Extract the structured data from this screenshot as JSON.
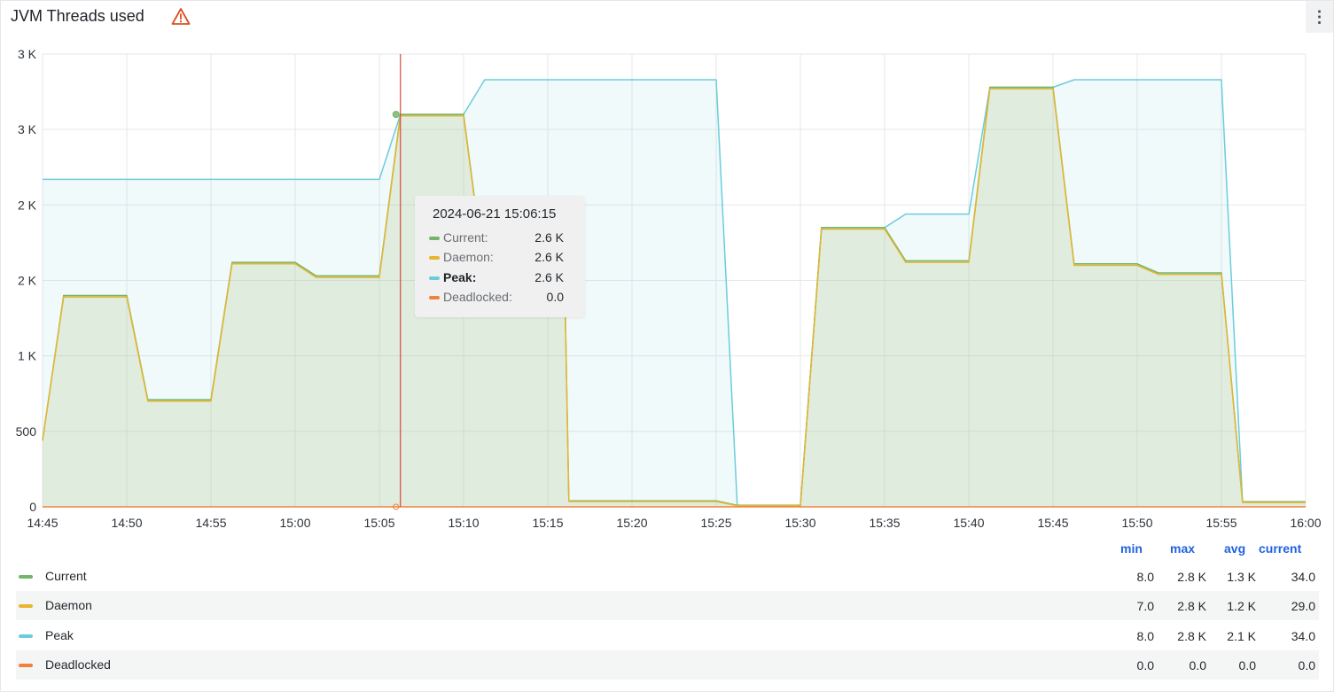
{
  "panel": {
    "title": "JVM Threads used",
    "warning_icon": "warning-triangle-icon",
    "menu_icon": "vertical-dots-icon",
    "warning_color": "#e35a1a"
  },
  "colors": {
    "current": "#73b56a",
    "daemon": "#e8b530",
    "peak": "#6cccdb",
    "deadlocked": "#f0803c",
    "cursor": "#d44a3a"
  },
  "chart_data": {
    "type": "area",
    "title": "JVM Threads used",
    "y_ticks": [
      "0",
      "500",
      "1 K",
      "2 K",
      "2 K",
      "3 K",
      "3 K"
    ],
    "y_tick_values": [
      0,
      500,
      1000,
      1500,
      2000,
      2500,
      3000
    ],
    "ylim": [
      0,
      3000
    ],
    "x_ticks": [
      "14:45",
      "14:50",
      "14:55",
      "15:00",
      "15:05",
      "15:10",
      "15:15",
      "15:20",
      "15:25",
      "15:30",
      "15:35",
      "15:40",
      "15:45",
      "15:50",
      "15:55",
      "16:00"
    ],
    "x_range_minutes": [
      0,
      75
    ],
    "grid": true,
    "series": [
      {
        "name": "Current",
        "color": "#73b56a",
        "points": [
          [
            0,
            440
          ],
          [
            1.25,
            1400
          ],
          [
            5,
            1400
          ],
          [
            6.25,
            710
          ],
          [
            10,
            710
          ],
          [
            11.25,
            1620
          ],
          [
            15,
            1620
          ],
          [
            16.25,
            1530
          ],
          [
            20,
            1530
          ],
          [
            21.25,
            2600
          ],
          [
            25,
            2600
          ],
          [
            26.25,
            1530
          ],
          [
            31,
            1530
          ],
          [
            31.25,
            40
          ],
          [
            40,
            40
          ],
          [
            41.25,
            10
          ],
          [
            45,
            10
          ],
          [
            46.25,
            1850
          ],
          [
            50,
            1850
          ],
          [
            51.25,
            1630
          ],
          [
            55,
            1630
          ],
          [
            56.25,
            2780
          ],
          [
            60,
            2780
          ],
          [
            61.25,
            1610
          ],
          [
            65,
            1610
          ],
          [
            66.25,
            1550
          ],
          [
            70,
            1550
          ],
          [
            71.25,
            34
          ],
          [
            75,
            34
          ]
        ]
      },
      {
        "name": "Daemon",
        "color": "#e8b530",
        "points": [
          [
            0,
            440
          ],
          [
            1.25,
            1390
          ],
          [
            5,
            1390
          ],
          [
            6.25,
            700
          ],
          [
            10,
            700
          ],
          [
            11.25,
            1610
          ],
          [
            15,
            1610
          ],
          [
            16.25,
            1520
          ],
          [
            20,
            1520
          ],
          [
            21.25,
            2590
          ],
          [
            25,
            2590
          ],
          [
            26.25,
            1520
          ],
          [
            31,
            1520
          ],
          [
            31.25,
            35
          ],
          [
            40,
            35
          ],
          [
            41.25,
            7
          ],
          [
            45,
            7
          ],
          [
            46.25,
            1840
          ],
          [
            50,
            1840
          ],
          [
            51.25,
            1620
          ],
          [
            55,
            1620
          ],
          [
            56.25,
            2770
          ],
          [
            60,
            2770
          ],
          [
            61.25,
            1600
          ],
          [
            65,
            1600
          ],
          [
            66.25,
            1540
          ],
          [
            70,
            1540
          ],
          [
            71.25,
            29
          ],
          [
            75,
            29
          ]
        ]
      },
      {
        "name": "Peak",
        "color": "#6cccdb",
        "points": [
          [
            0,
            2170
          ],
          [
            20,
            2170
          ],
          [
            21.25,
            2600
          ],
          [
            25,
            2600
          ],
          [
            26.25,
            2830
          ],
          [
            40,
            2830
          ],
          [
            41.25,
            8
          ],
          [
            45,
            8
          ],
          [
            46.25,
            1850
          ],
          [
            50,
            1850
          ],
          [
            51.25,
            1940
          ],
          [
            55,
            1940
          ],
          [
            56.25,
            2780
          ],
          [
            60,
            2780
          ],
          [
            61.25,
            2830
          ],
          [
            70,
            2830
          ],
          [
            71.25,
            34
          ],
          [
            75,
            34
          ]
        ]
      },
      {
        "name": "Deadlocked",
        "color": "#f0803c",
        "points": [
          [
            0,
            0
          ],
          [
            75,
            0
          ]
        ]
      }
    ]
  },
  "tooltip": {
    "time": "2024-06-21 15:06:15",
    "rows": [
      {
        "label": "Current:",
        "value": "2.6 K"
      },
      {
        "label": "Daemon:",
        "value": "2.6 K"
      },
      {
        "label": "Peak:",
        "value": "2.6 K"
      },
      {
        "label": "Deadlocked:",
        "value": "0.0"
      }
    ]
  },
  "legend": {
    "headers": [
      "min",
      "max",
      "avg",
      "current"
    ],
    "rows": [
      {
        "name": "Current",
        "min": "8.0",
        "max": "2.8 K",
        "avg": "1.3 K",
        "current": "34.0"
      },
      {
        "name": "Daemon",
        "min": "7.0",
        "max": "2.8 K",
        "avg": "1.2 K",
        "current": "29.0"
      },
      {
        "name": "Peak",
        "min": "8.0",
        "max": "2.8 K",
        "avg": "2.1 K",
        "current": "34.0"
      },
      {
        "name": "Deadlocked",
        "min": "0.0",
        "max": "0.0",
        "avg": "0.0",
        "current": "0.0"
      }
    ]
  }
}
